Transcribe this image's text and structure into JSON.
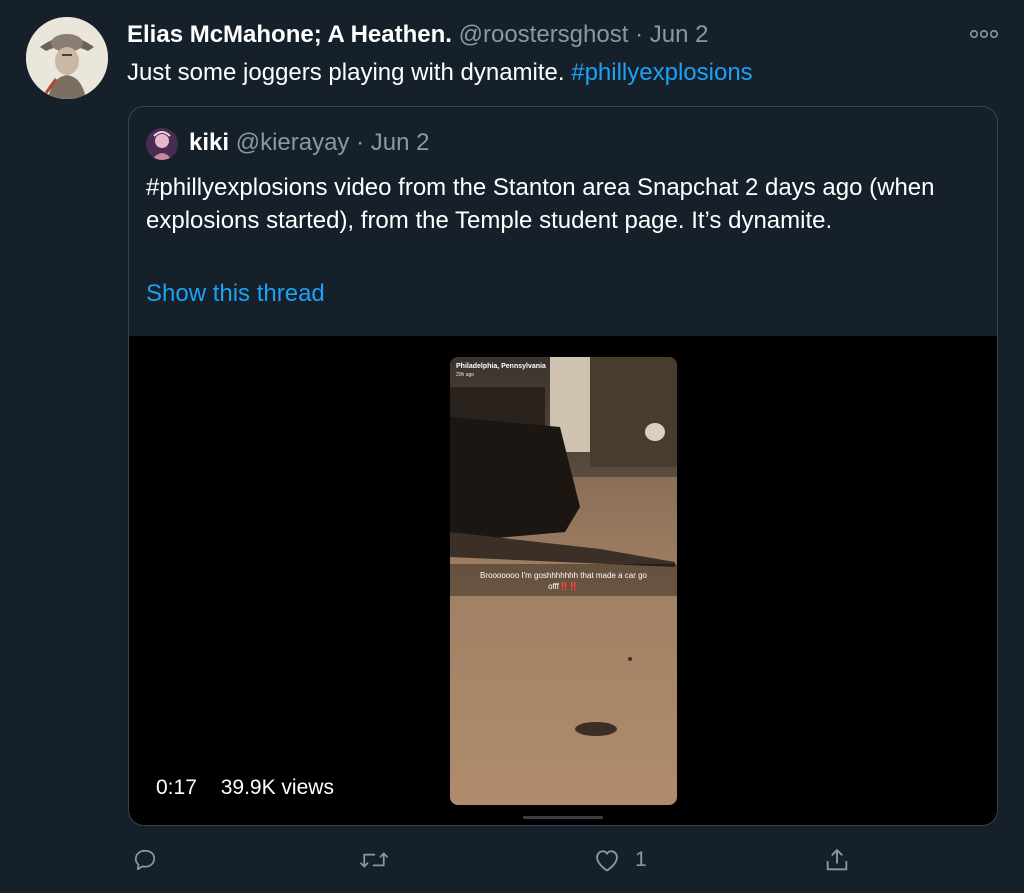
{
  "tweet": {
    "author_name": "Elias McMahone; A Heathen.",
    "handle": "@roostersghost",
    "separator": "·",
    "date": "Jun 2",
    "text": "Just some joggers playing with dynamite.",
    "hashtag": "#phillyexplosions",
    "more_icon": "more-icon"
  },
  "quoted_tweet": {
    "author_name": "kiki",
    "handle": "@kierayay",
    "separator": "·",
    "date": "Jun 2",
    "text": "#phillyexplosions video from the Stanton area Snapchat 2 days ago (when explosions started), from the Temple student page. It’s dynamite.",
    "show_thread": "Show this thread"
  },
  "video": {
    "location_label": "Philadelphia, Pennsylvania",
    "time_ago": "20h ago",
    "caption_line1": "Brooooooo I'm goshhhhhhh that made a car go",
    "caption_line2": "offf",
    "caption_emphasis": "‼️‼️",
    "duration": "0:17",
    "views": "39.9K views"
  },
  "actions": {
    "reply_icon": "reply-icon",
    "retweet_icon": "retweet-icon",
    "like_icon": "like-icon",
    "like_count": "1",
    "share_icon": "share-icon"
  },
  "colors": {
    "background": "#15202b",
    "link": "#1da1f2",
    "muted": "#8899a6",
    "border": "#38444d"
  }
}
